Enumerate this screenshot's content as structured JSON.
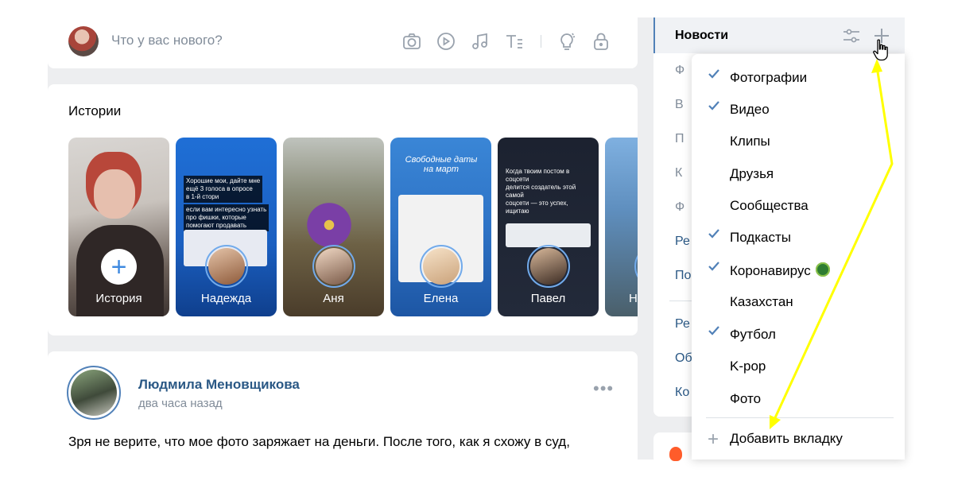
{
  "composer": {
    "placeholder": "Что у вас нового?",
    "tools": [
      "camera-icon",
      "video-icon",
      "music-icon",
      "text-icon",
      "idea-icon",
      "lock-icon"
    ]
  },
  "stories": {
    "title": "Истории",
    "items": [
      {
        "name": "История",
        "kind": "add"
      },
      {
        "name": "Надежда",
        "kind": "story"
      },
      {
        "name": "Аня",
        "kind": "story"
      },
      {
        "name": "Елена",
        "kind": "story"
      },
      {
        "name": "Павел",
        "kind": "story"
      },
      {
        "name": "Н",
        "kind": "story"
      }
    ],
    "nadezhda_text": [
      "Хорошие мои, дайте мне",
      "ещё 3 голоса в опросе",
      "в 1-й стори",
      "если вам интересно узнать",
      "про фишки, которые",
      "помогают продавать"
    ],
    "elena_text": "Свободные даты на март",
    "pavel_text": [
      "Когда твоим постом в соцсети",
      "делится создатель этой самой",
      "соцсети — это успех, ищитаю"
    ]
  },
  "post": {
    "author": "Людмила Меновщикова",
    "time": "два часа назад",
    "more": "•••",
    "text": "Зря не верите, что мое фото заряжает на деньги. После того, как я схожу в суд,"
  },
  "rightmenu": {
    "active": "Новости",
    "hidden_items": [
      "Ф",
      "В",
      "П",
      "К",
      "Ф"
    ],
    "items_blue": [
      "Ре",
      "По",
      "Ре",
      "Об",
      "Ко"
    ]
  },
  "dropdown": {
    "items": [
      {
        "label": "Фотографии",
        "checked": true
      },
      {
        "label": "Видео",
        "checked": true
      },
      {
        "label": "Клипы",
        "checked": false
      },
      {
        "label": "Друзья",
        "checked": false
      },
      {
        "label": "Сообщества",
        "checked": false
      },
      {
        "label": "Подкасты",
        "checked": true
      },
      {
        "label": "Коронавирус",
        "checked": true
      },
      {
        "label": "Казахстан",
        "checked": false
      },
      {
        "label": "Футбол",
        "checked": true
      },
      {
        "label": "K-pop",
        "checked": false
      },
      {
        "label": "Фото",
        "checked": false
      }
    ],
    "add_label": "Добавить вкладку"
  },
  "colors": {
    "accent": "#5181b8",
    "link": "#2a5885",
    "annotation": "#ffff00"
  }
}
